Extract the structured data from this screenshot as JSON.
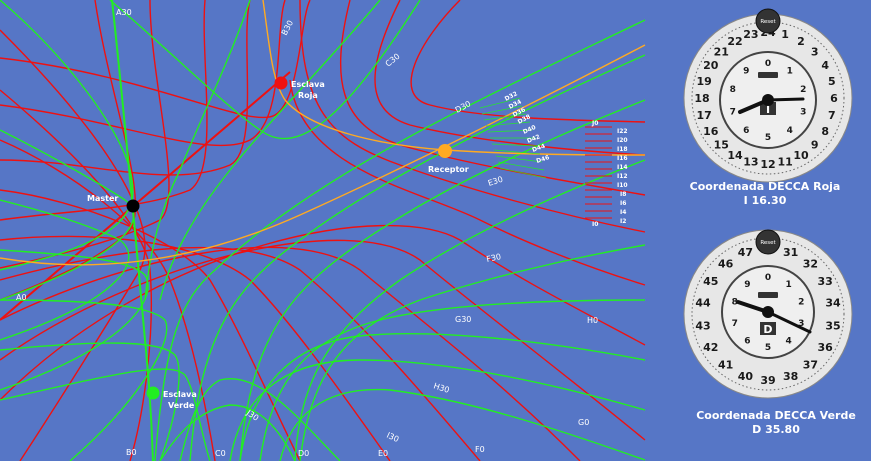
{
  "colors": {
    "background": "#5676c6",
    "red": "#ee1111",
    "green": "#22ee22",
    "orange": "#ffaa22",
    "white": "#ffffff"
  },
  "map": {
    "stations": {
      "master": "Master",
      "red_slave": [
        "Esclava",
        "Roja"
      ],
      "green_slave": [
        "Esclava",
        "Verde"
      ],
      "receiver": "Receptor"
    },
    "line_labels": {
      "a30": "A30",
      "a0": "A0",
      "b30": "B30",
      "b0": "B0",
      "c30": "C30",
      "c0": "C0",
      "d30": "D30",
      "d0": "D0",
      "e30": "E30",
      "e0": "E0",
      "f30": "F30",
      "f0": "F0",
      "g30": "G30",
      "g0": "G0",
      "h30": "H30",
      "h0": "H0",
      "i30": "I30",
      "j30": "J30"
    },
    "lane_d": [
      "D32",
      "D34",
      "D36",
      "D38",
      "D40",
      "D42",
      "D44",
      "D46"
    ],
    "lane_i": [
      "J0",
      "I22",
      "I20",
      "I18",
      "I16",
      "I14",
      "I12",
      "I10",
      "I8",
      "I6",
      "I4",
      "I2",
      "I0"
    ]
  },
  "dials": {
    "reset_label": "Reset",
    "red": {
      "numbers": [
        "24",
        "1",
        "2",
        "3",
        "4",
        "5",
        "6",
        "7",
        "8",
        "9",
        "10",
        "11",
        "12",
        "13",
        "14",
        "15",
        "16",
        "17",
        "18",
        "19",
        "20",
        "21",
        "22",
        "23"
      ],
      "inner": [
        "0",
        "1",
        "2",
        "3",
        "4",
        "5",
        "6",
        "7",
        "8",
        "9"
      ],
      "letter": "I",
      "caption": "Coordenada DECCA Roja",
      "value": "I 16.30"
    },
    "green": {
      "numbers": [
        "30",
        "31",
        "32",
        "33",
        "34",
        "35",
        "36",
        "37",
        "38",
        "39",
        "40",
        "41",
        "42",
        "43",
        "44",
        "45",
        "46",
        "47"
      ],
      "inner": [
        "0",
        "1",
        "2",
        "3",
        "4",
        "5",
        "6",
        "7",
        "8",
        "9"
      ],
      "letter": "D",
      "caption": "Coordenada DECCA Verde",
      "value": "D 35.80"
    }
  }
}
